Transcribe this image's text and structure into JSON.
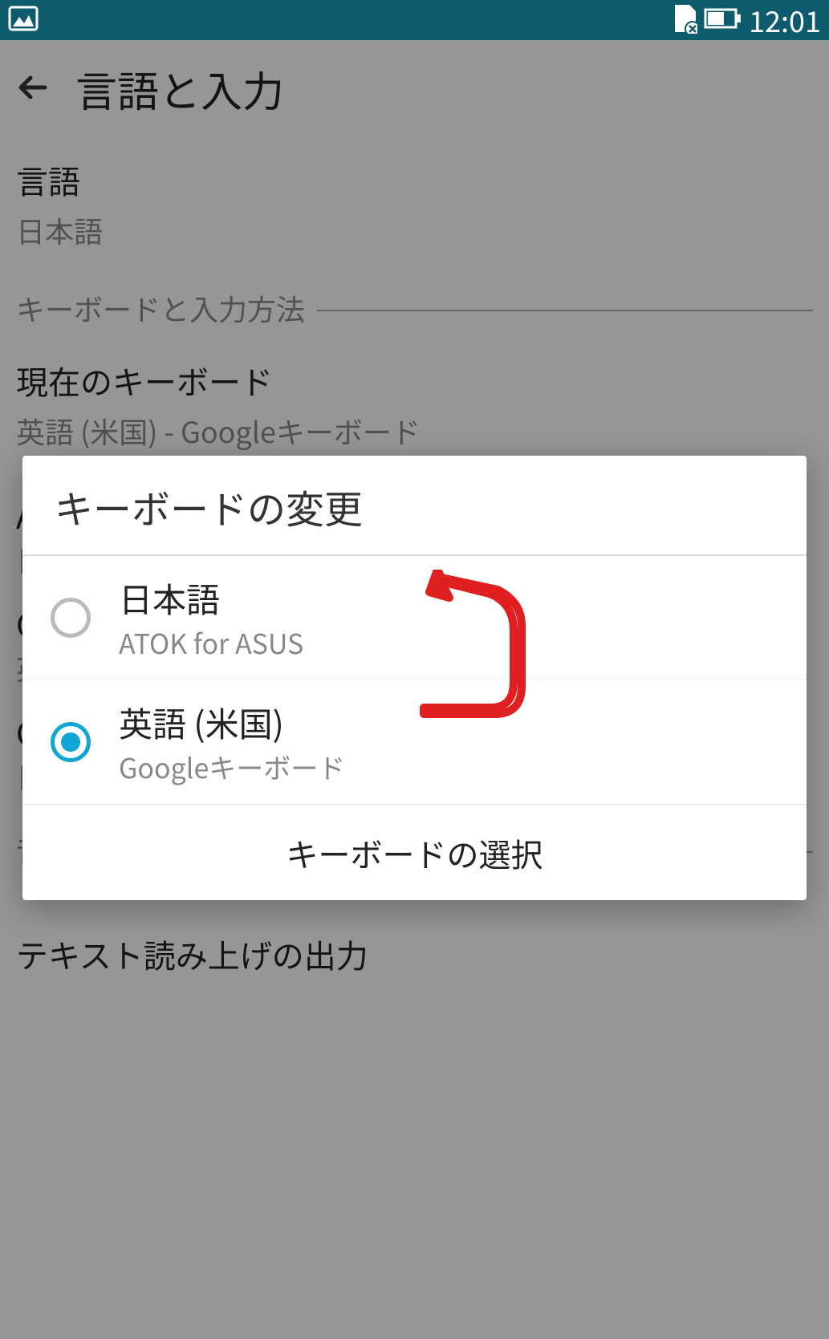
{
  "status_bar": {
    "time": "12:01",
    "icons": {
      "notification": "image-icon",
      "sim": "sim-error-icon",
      "battery": "battery-icon"
    }
  },
  "app_bar": {
    "title": "言語と入力"
  },
  "settings": {
    "language": {
      "label": "言語",
      "value": "日本語"
    },
    "keyboard_section": "キーボードと入力方法",
    "current_keyboard": {
      "label": "現在のキーボード",
      "value": "英語 (米国) - Googleキーボード"
    },
    "hidden_items": [
      {
        "label_prefix": "A",
        "sub_prefix": "日"
      },
      {
        "label_prefix": "C",
        "sub_prefix": "英"
      },
      {
        "label_prefix": "C",
        "sub_prefix": "日"
      }
    ],
    "voice_section": "音声",
    "tts": {
      "label": "テキスト読み上げの出力"
    }
  },
  "dialog": {
    "title": "キーボードの変更",
    "options": [
      {
        "primary": "日本語",
        "secondary": "ATOK for ASUS",
        "selected": false
      },
      {
        "primary": "英語 (米国)",
        "secondary": "Googleキーボード",
        "selected": true
      }
    ],
    "action_button": "キーボードの選択"
  }
}
